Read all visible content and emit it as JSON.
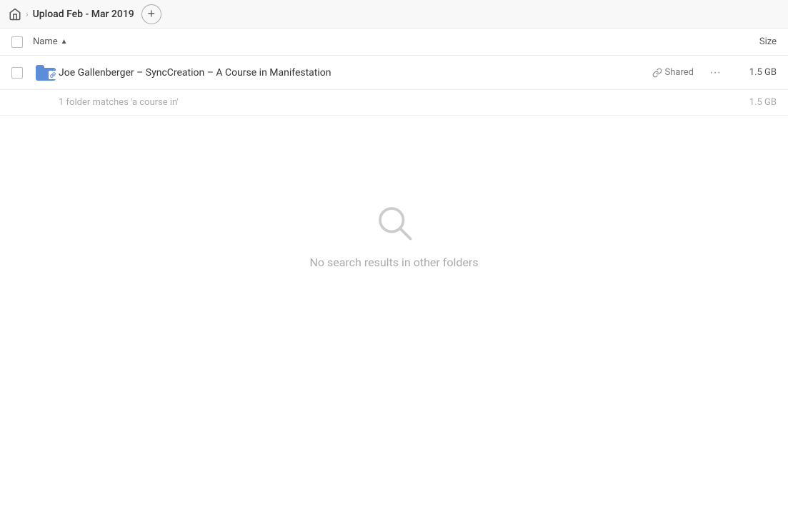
{
  "breadcrumb": {
    "home_label": "Home",
    "path_label": "Upload Feb - Mar 2019"
  },
  "add_button_label": "+",
  "columns": {
    "name_label": "Name",
    "size_label": "Size"
  },
  "file_row": {
    "name": "Joe Gallenberger – SyncCreation – A Course in Manifestation",
    "shared_label": "Shared",
    "size": "1.5 GB"
  },
  "match_info": {
    "text": "1 folder matches 'a course in'",
    "size": "1.5 GB"
  },
  "no_results": {
    "icon": "🔍",
    "text": "No search results in other folders"
  }
}
